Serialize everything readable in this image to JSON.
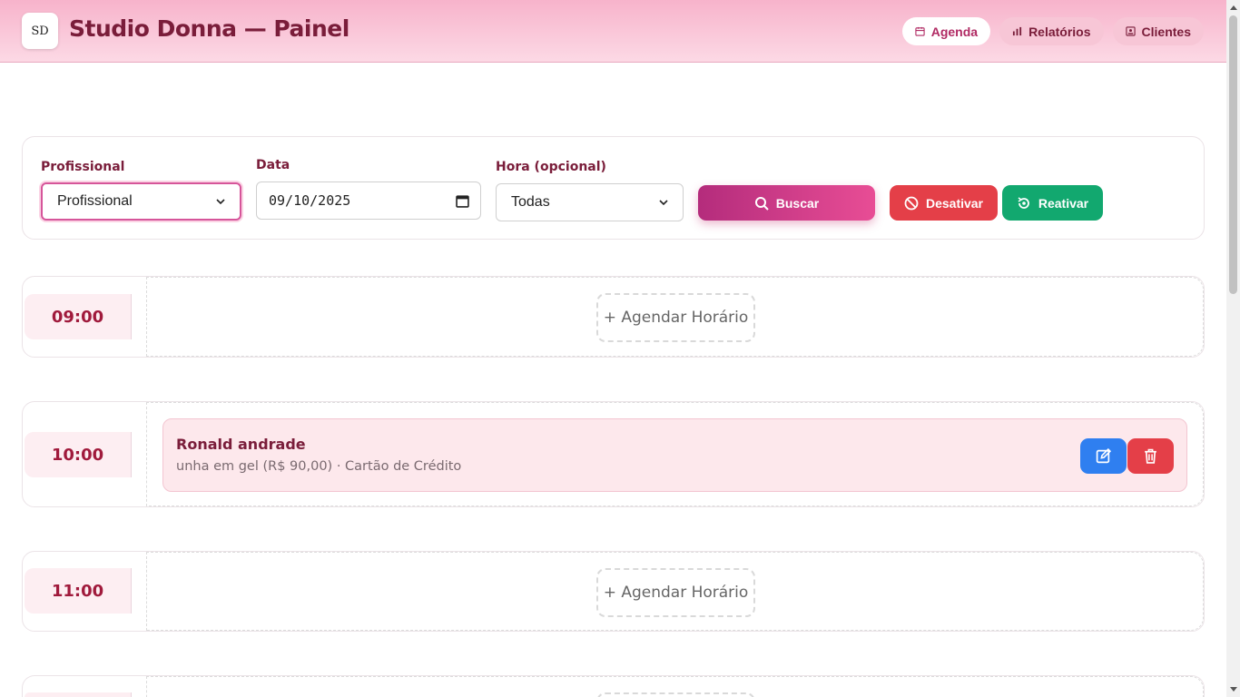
{
  "header": {
    "logo_text": "SD",
    "title": "Studio Donna — Painel",
    "nav": [
      {
        "label": "Agenda",
        "icon": "calendar-icon",
        "active": true
      },
      {
        "label": "Relatórios",
        "icon": "bar-chart-icon",
        "active": false
      },
      {
        "label": "Clientes",
        "icon": "contact-card-icon",
        "active": false
      }
    ]
  },
  "filters": {
    "profissional_label": "Profissional",
    "profissional_value": "Profissional",
    "data_label": "Data",
    "data_value": "09/10/2025",
    "hora_label": "Hora (opcional)",
    "hora_value": "Todas",
    "buscar_label": "Buscar",
    "desativar_label": "Desativar",
    "reativar_label": "Reativar"
  },
  "schedule": [
    {
      "time": "09:00",
      "empty_label": "+ Agendar Horário"
    },
    {
      "time": "10:00",
      "appointment": {
        "client": "Ronald andrade",
        "details": "unha em gel (R$ 90,00) · Cartão de Crédito"
      }
    },
    {
      "time": "11:00",
      "empty_label": "+ Agendar Horário"
    }
  ],
  "colors": {
    "brand": "#7a1d3a",
    "accent": "#e84d95",
    "danger": "#e43f48",
    "success": "#12a86f",
    "edit": "#2f7ff0"
  }
}
